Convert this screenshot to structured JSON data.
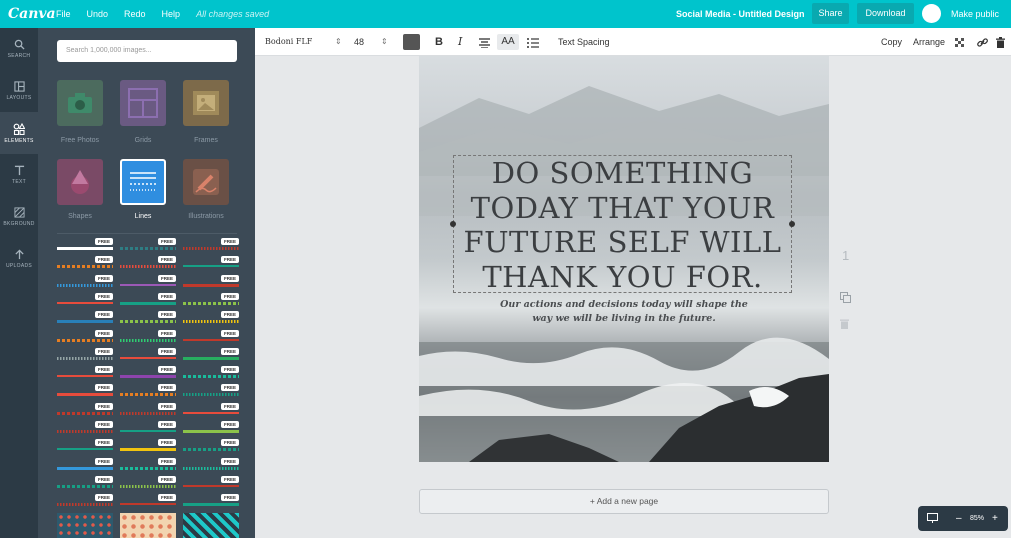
{
  "app": {
    "logo": "Canva"
  },
  "menu": {
    "file": "File",
    "undo": "Undo",
    "redo": "Redo",
    "help": "Help",
    "status": "All changes saved"
  },
  "header": {
    "doc_title": "Social Media - Untitled Design",
    "share": "Share",
    "download": "Download",
    "make_public": "Make public"
  },
  "rail": [
    {
      "label": "SEARCH",
      "icon": "search-icon"
    },
    {
      "label": "LAYOUTS",
      "icon": "layouts-icon"
    },
    {
      "label": "ELEMENTS",
      "icon": "elements-icon"
    },
    {
      "label": "TEXT",
      "icon": "text-icon"
    },
    {
      "label": "BKGROUND",
      "icon": "background-icon"
    },
    {
      "label": "UPLOADS",
      "icon": "upload-icon"
    }
  ],
  "panel": {
    "search_placeholder": "Search 1,000,000 images...",
    "categories": [
      {
        "label": "Free Photos",
        "icon": "camera-icon"
      },
      {
        "label": "Grids",
        "icon": "grid-icon"
      },
      {
        "label": "Frames",
        "icon": "frame-icon"
      },
      {
        "label": "Shapes",
        "icon": "shapes-icon"
      },
      {
        "label": "Lines",
        "icon": "lines-icon"
      },
      {
        "label": "Illustrations",
        "icon": "pencil-icon"
      }
    ],
    "free_badge": "FREE",
    "line_colors": [
      [
        "#ffffff",
        "#2e7d83",
        "#c0392b"
      ],
      [
        "#e67e22",
        "#e74c3c",
        "#16a085"
      ],
      [
        "#3498db",
        "#9b59b6",
        "#c0392b"
      ],
      [
        "#e74c3c",
        "#16a085",
        "#8bc34a"
      ],
      [
        "#2980b9",
        "#8bc34a",
        "#f1c40f"
      ],
      [
        "#e67e22",
        "#2ecc71",
        "#c0392b"
      ],
      [
        "#95a5a6",
        "#e74c3c",
        "#27ae60"
      ],
      [
        "#e74c3c",
        "#8e44ad",
        "#1abc9c"
      ],
      [
        "#e74c3c",
        "#e67e22",
        "#16a085"
      ],
      [
        "#c0392b",
        "#c0392b",
        "#e74c3c"
      ],
      [
        "#c0392b",
        "#16a085",
        "#8bc34a"
      ],
      [
        "#16a085",
        "#f1c40f",
        "#16a085"
      ],
      [
        "#3498db",
        "#1abc9c",
        "#1abc9c"
      ],
      [
        "#16a085",
        "#8bc34a",
        "#c0392b"
      ],
      [
        "#c0392b",
        "#c0392b",
        "#16a085"
      ],
      [
        "#3498db",
        "#3498db",
        "#2980b9"
      ]
    ]
  },
  "toolbar": {
    "font": "Bodoni FLF",
    "size": "48",
    "bold": "B",
    "italic": "I",
    "case": "AA",
    "text_spacing": "Text Spacing",
    "copy": "Copy",
    "arrange": "Arrange"
  },
  "canvas": {
    "quote": "DO SOMETHING TODAY THAT YOUR FUTURE SELF WILL THANK YOU FOR.",
    "subtitle_line1": "Our actions and decisions today will shape the",
    "subtitle_line2": "way we will be living in the future."
  },
  "page_number": "1",
  "add_page": "+ Add a new page",
  "zoom": {
    "value": "85%",
    "minus": "–",
    "plus": "+"
  }
}
